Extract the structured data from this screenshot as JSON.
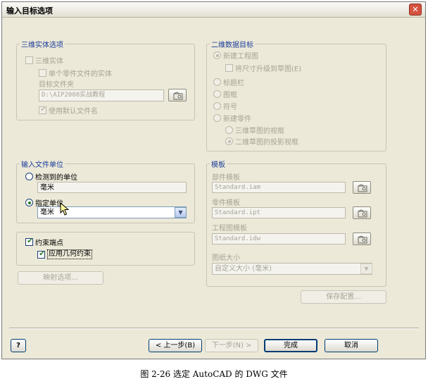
{
  "window": {
    "title": "输入目标选项",
    "close_glyph": "✕"
  },
  "solid_options": {
    "label": "三维实体选项",
    "solid_checkbox": "三维实体",
    "single_part_checkbox": "单个零件文件的实体",
    "target_folder_label": "目标文件夹",
    "target_folder_value": "D:\\AIP2008实战教程",
    "use_default_filename": "使用默认文件名"
  },
  "data_2d_target": {
    "label": "二维数据目标",
    "new_drawing": "新建工程图",
    "scale_to_sketch": "将尺寸升级到草图(E)",
    "title_block": "标题栏",
    "border": "图框",
    "symbol": "符号",
    "new_part": "新建零件",
    "sketch_3d_view": "三维草图的视框",
    "sketch_2d_projection": "二维草图的投影视框"
  },
  "input_units": {
    "label": "输入文件单位",
    "detected_units_radio": "检测到的单位",
    "detected_units_value": "毫米",
    "specified_units_radio": "指定单位",
    "specified_units_value": "毫米"
  },
  "constraints": {
    "constrain_endpoints": "约束端点",
    "apply_geometric_constraints": "应用几何约束"
  },
  "mapping_button": "映射选项...",
  "templates": {
    "label": "模板",
    "part_template_label": "部件模板",
    "part_template_value": "Standard.iam",
    "component_template_label": "零件模板",
    "component_template_value": "Standard.ipt",
    "drawing_template_label": "工程图模板",
    "drawing_template_value": "Standard.idw",
    "sheet_size_label": "图纸大小",
    "sheet_size_value": "自定义大小 (毫米)"
  },
  "save_config_button": "保存配置...",
  "footer": {
    "help_glyph": "?",
    "back_button": "< 上一步(B)",
    "next_button": "下一步(N) >",
    "finish_button": "完成",
    "cancel_button": "取消"
  },
  "caption": "图 2-26  选定 AutoCAD 的 DWG 文件",
  "colors": {
    "accent": "#003c74",
    "disabled_text": "#a7a496",
    "dialog_bg": "#ece9d8"
  },
  "icons": [
    "browse-folder-icon",
    "help-icon",
    "mouse-cursor-icon",
    "close-icon",
    "checkmark-icon",
    "dropdown-arrow-icon"
  ]
}
